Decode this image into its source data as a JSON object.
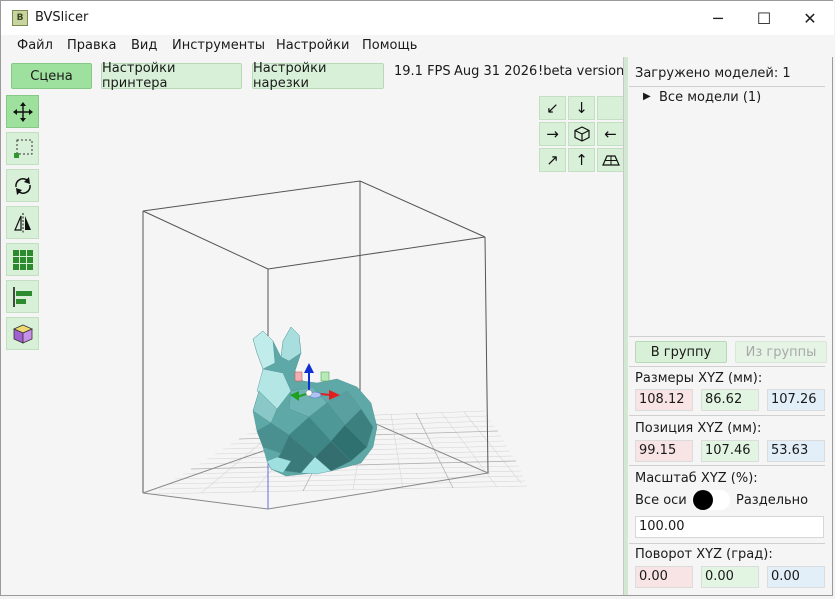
{
  "window": {
    "title": "BVSlicer",
    "icon_letter": "B",
    "controls": {
      "minimize": "─",
      "maximize": "☐",
      "close": "✕"
    }
  },
  "menu": [
    "Файл",
    "Правка",
    "Вид",
    "Инструменты",
    "Настройки",
    "Помощь"
  ],
  "toolbar": {
    "tabs": [
      "Сцена",
      "Настройки принтера",
      "Настройки нарезки"
    ],
    "active_tab": "Сцена",
    "fps": "19.1 FPS",
    "date": "Aug 31 2026",
    "version": "!beta version!"
  },
  "left_tools": [
    {
      "name": "move-icon",
      "active": true
    },
    {
      "name": "select-icon",
      "active": false
    },
    {
      "name": "rotate-icon",
      "active": false
    },
    {
      "name": "mirror-icon",
      "active": false
    },
    {
      "name": "arrange-grid-icon",
      "active": false
    },
    {
      "name": "align-icon",
      "active": false
    },
    {
      "name": "cube-icon",
      "active": false
    }
  ],
  "view_nav": {
    "row1": [
      "↙",
      "↓",
      ""
    ],
    "row2": [
      "→",
      "cube",
      "←"
    ],
    "row3": [
      "↗",
      "↑",
      "plane"
    ]
  },
  "panel": {
    "loaded_models": "Загружено моделей: 1",
    "tree_root": "Все модели (1)",
    "group_button": "В группу",
    "ungroup_button": "Из группы",
    "size_label": "Размеры XYZ (мм):",
    "size": {
      "x": "108.12",
      "y": "86.62",
      "z": "107.26"
    },
    "position_label": "Позиция XYZ (мм):",
    "position": {
      "x": "99.15",
      "y": "107.46",
      "z": "53.63"
    },
    "scale_label": "Масштаб XYZ (%):",
    "scale_all_axes": "Все оси",
    "scale_separate": "Раздельно",
    "scale_value": "100.00",
    "rotation_label": "Поворот XYZ (град):",
    "rotation": {
      "x": "0.00",
      "y": "0.00",
      "z": "0.00"
    }
  },
  "colors": {
    "button_bg": "#d8f0d8",
    "button_active": "#9ee09e",
    "model": "#5fa8a8",
    "axis_x": "#e02020",
    "axis_y": "#20a020",
    "axis_z": "#1030d0"
  }
}
